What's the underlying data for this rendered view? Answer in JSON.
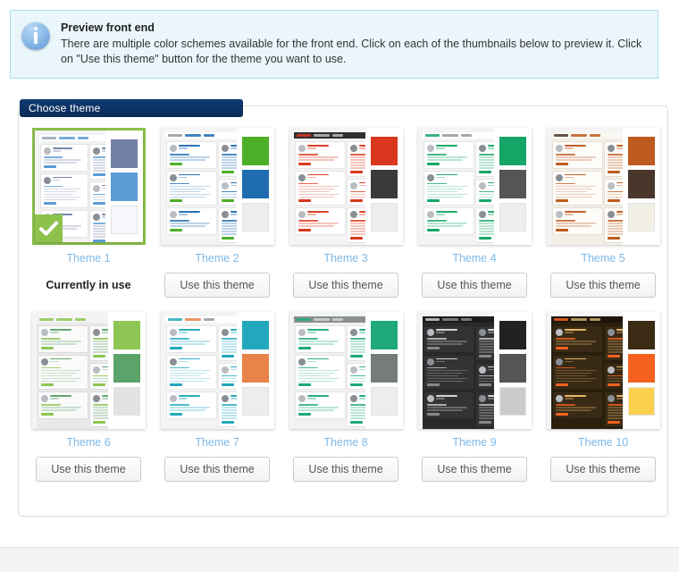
{
  "notice": {
    "icon": "info-icon",
    "title": "Preview front end",
    "body": "There are multiple color schemes available for the front end. Click on each of the thumbnails below to preview it. Click on \"Use this theme\" button for the theme you want to use."
  },
  "panel": {
    "tab_label": "Choose theme"
  },
  "labels": {
    "use_this_theme": "Use this theme",
    "currently_in_use": "Currently in use"
  },
  "colors": {
    "accent_link": "#7eb9e8",
    "selected_border": "#8cc14c",
    "notice_bg": "#eaf6fc",
    "notice_border": "#a9dcf0",
    "tab_bg": "#0d3060"
  },
  "themes": [
    {
      "name": "Theme 1",
      "selected": true,
      "action": "currently_in_use",
      "swatches": [
        "#7380a5",
        "#5b9bd5",
        "#f5f7fa"
      ],
      "preview": {
        "page_bg": "#f2f2f2",
        "nav_bg": "#ffffff",
        "nav_items": [
          "#9aa3b5",
          "#5b9bd5",
          "#5b9bd5"
        ],
        "card_bg": "#ffffff",
        "text": "#7380a5",
        "accent": "#5b9bd5",
        "tag": "#5b9bd5"
      }
    },
    {
      "name": "Theme 2",
      "selected": false,
      "action": "use_this_theme",
      "swatches": [
        "#4caf28",
        "#1f6cb0",
        "#ededed"
      ],
      "preview": {
        "page_bg": "#f4f4f4",
        "nav_bg": "#ffffff",
        "nav_items": [
          "#999999",
          "#1f6cb0",
          "#1f6cb0"
        ],
        "card_bg": "#ffffff",
        "text": "#1f6cb0",
        "accent": "#1f6cb0",
        "tag": "#4caf28"
      }
    },
    {
      "name": "Theme 3",
      "selected": false,
      "action": "use_this_theme",
      "swatches": [
        "#d9381e",
        "#3a3a3a",
        "#ededed"
      ],
      "preview": {
        "page_bg": "#f4f4f4",
        "nav_bg": "#2f2f2f",
        "nav_items": [
          "#d9381e",
          "#bbbbbb",
          "#bbbbbb"
        ],
        "card_bg": "#ffffff",
        "text": "#d9381e",
        "accent": "#d9381e",
        "tag": "#d9381e"
      }
    },
    {
      "name": "Theme 4",
      "selected": false,
      "action": "use_this_theme",
      "swatches": [
        "#16a668",
        "#555555",
        "#ededed"
      ],
      "preview": {
        "page_bg": "#f4f4f4",
        "nav_bg": "#ffffff",
        "nav_items": [
          "#16a668",
          "#999999",
          "#999999"
        ],
        "card_bg": "#ffffff",
        "text": "#16a668",
        "accent": "#16a668",
        "tag": "#16a668"
      }
    },
    {
      "name": "Theme 5",
      "selected": false,
      "action": "use_this_theme",
      "swatches": [
        "#bf5a20",
        "#4a372c",
        "#f2efe4"
      ],
      "preview": {
        "page_bg": "#f3efe6",
        "nav_bg": "#faf8f2",
        "nav_items": [
          "#4a372c",
          "#bf5a20",
          "#bf5a20"
        ],
        "card_bg": "#fdfcf8",
        "text": "#bf5a20",
        "accent": "#bf5a20",
        "tag": "#bf5a20"
      }
    },
    {
      "name": "Theme 6",
      "selected": false,
      "action": "use_this_theme",
      "swatches": [
        "#8dc653",
        "#5ba368",
        "#e2e2e2"
      ],
      "preview": {
        "page_bg": "#e9e9e9",
        "nav_bg": "#f4f4f4",
        "nav_items": [
          "#8dc653",
          "#8dc653",
          "#8dc653"
        ],
        "card_bg": "#fafafa",
        "text": "#5ba368",
        "accent": "#8dc653",
        "tag": "#8dc653"
      }
    },
    {
      "name": "Theme 7",
      "selected": false,
      "action": "use_this_theme",
      "swatches": [
        "#22a8bd",
        "#e8834a",
        "#ededed"
      ],
      "preview": {
        "page_bg": "#f4f4f4",
        "nav_bg": "#ffffff",
        "nav_items": [
          "#22a8bd",
          "#e8834a",
          "#999999"
        ],
        "card_bg": "#ffffff",
        "text": "#22a8bd",
        "accent": "#22a8bd",
        "tag": "#22a8bd"
      }
    },
    {
      "name": "Theme 8",
      "selected": false,
      "action": "use_this_theme",
      "swatches": [
        "#1ea87c",
        "#767d78",
        "#ededed"
      ],
      "preview": {
        "page_bg": "#f2f2f2",
        "nav_bg": "#8a918c",
        "nav_items": [
          "#1ea87c",
          "#cfd4d0",
          "#cfd4d0"
        ],
        "card_bg": "#ffffff",
        "text": "#1ea87c",
        "accent": "#1ea87c",
        "tag": "#1ea87c"
      }
    },
    {
      "name": "Theme 9",
      "selected": false,
      "action": "use_this_theme",
      "swatches": [
        "#222222",
        "#555555",
        "#cccccc"
      ],
      "preview": {
        "page_bg": "#2a2a2a",
        "nav_bg": "#1c1c1c",
        "nav_items": [
          "#cccccc",
          "#888888",
          "#888888"
        ],
        "card_bg": "#333333",
        "text": "#dddddd",
        "accent": "#cccccc",
        "tag": "#888888"
      }
    },
    {
      "name": "Theme 10",
      "selected": false,
      "action": "use_this_theme",
      "swatches": [
        "#3b2a14",
        "#f4611f",
        "#fbd04d"
      ],
      "preview": {
        "page_bg": "#2b1f0d",
        "nav_bg": "#1d1509",
        "nav_items": [
          "#f4611f",
          "#c9a96a",
          "#c9a96a"
        ],
        "card_bg": "#382a15",
        "text": "#f0c070",
        "accent": "#f4611f",
        "tag": "#f4611f"
      }
    }
  ]
}
